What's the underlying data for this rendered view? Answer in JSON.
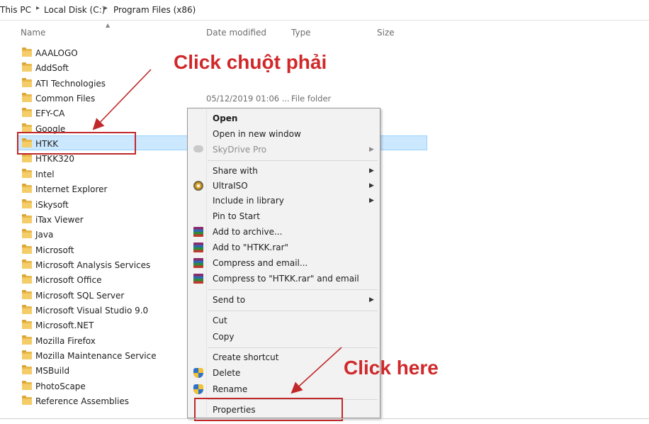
{
  "breadcrumb": [
    "This PC",
    "Local Disk (C:)",
    "Program Files (x86)"
  ],
  "columns": {
    "name": "Name",
    "date": "Date modified",
    "type": "Type",
    "size": "Size"
  },
  "files": [
    "AAALOGO",
    "AddSoft",
    "ATI Technologies",
    "Common Files",
    "EFY-CA",
    "Google",
    "HTKK",
    "HTKK320",
    "Intel",
    "Internet Explorer",
    "iSkysoft",
    "iTax Viewer",
    "Java",
    "Microsoft",
    "Microsoft Analysis Services",
    "Microsoft Office",
    "Microsoft SQL Server",
    "Microsoft Visual Studio 9.0",
    "Microsoft.NET",
    "Mozilla Firefox",
    "Mozilla Maintenance Service",
    "MSBuild",
    "PhotoScape",
    "Reference Assemblies"
  ],
  "selected_file": "HTKK",
  "visible_meta": {
    "date": "05/12/2019 01:06 ...",
    "type": "File folder"
  },
  "context_menu": {
    "open": "Open",
    "open_new_window": "Open in new window",
    "skydrive_pro": "SkyDrive Pro",
    "share_with": "Share with",
    "ultraiso": "UltraISO",
    "include_in_library": "Include in library",
    "pin_to_start": "Pin to Start",
    "add_to_archive": "Add to archive...",
    "add_to_rar": "Add to \"HTKK.rar\"",
    "compress_email": "Compress and email...",
    "compress_rar_email": "Compress to \"HTKK.rar\" and email",
    "send_to": "Send to",
    "cut": "Cut",
    "copy": "Copy",
    "create_shortcut": "Create shortcut",
    "delete": "Delete",
    "rename": "Rename",
    "properties": "Properties"
  },
  "annotations": {
    "click_right": "Click chuột phải",
    "click_here": "Click here"
  },
  "colors": {
    "annotation": "#d0282b",
    "selection": "#cce8ff"
  }
}
